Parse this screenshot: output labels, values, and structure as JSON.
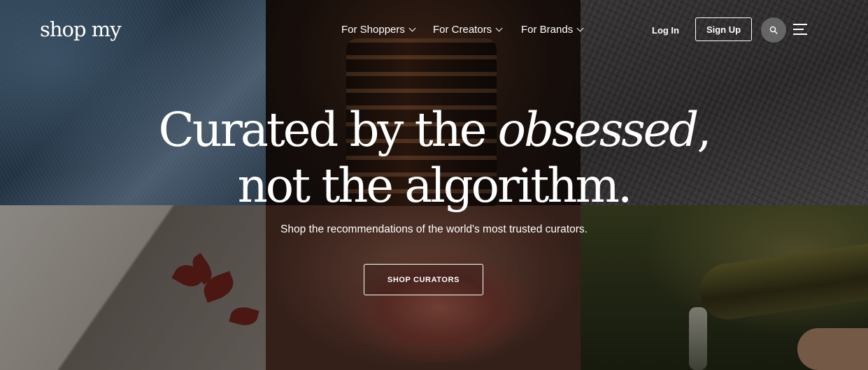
{
  "header": {
    "logo": "shop my",
    "nav": [
      {
        "label": "For Shoppers"
      },
      {
        "label": "For Creators"
      },
      {
        "label": "For Brands"
      }
    ],
    "login_label": "Log In",
    "signup_label": "Sign Up",
    "search_icon": "search-icon",
    "menu_icon": "hamburger-menu-icon"
  },
  "hero": {
    "headline_part1": "Curated by the ",
    "headline_emphasis": "obsessed",
    "headline_part2": ",",
    "headline_line2": "not the algorithm.",
    "subtitle": "Shop the recommendations of the world's most trusted curators.",
    "cta_label": "SHOP CURATORS"
  },
  "colors": {
    "text": "#ffffff",
    "overlay": "#120c0a"
  }
}
